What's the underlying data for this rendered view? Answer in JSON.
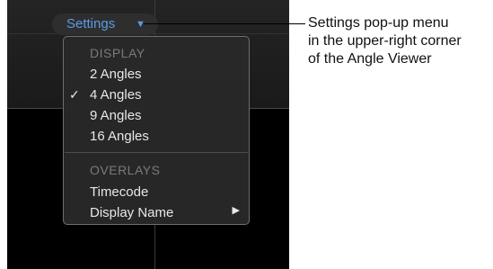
{
  "settings_button": {
    "label": "Settings",
    "arrow": "▼"
  },
  "menu": {
    "display_header": "DISPLAY",
    "display_items": [
      "2 Angles",
      "4 Angles",
      "9 Angles",
      "16 Angles"
    ],
    "checked_item": "4 Angles",
    "check_mark": "✓",
    "overlays_header": "OVERLAYS",
    "overlay_items": [
      "Timecode",
      "Display Name"
    ],
    "submenu_arrow": "▶"
  },
  "callout": {
    "lines": [
      "Settings pop-up menu",
      "in the upper-right corner",
      "of the Angle Viewer"
    ]
  }
}
